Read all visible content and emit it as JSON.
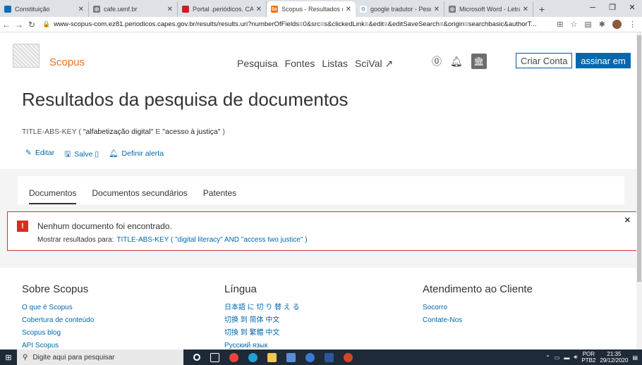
{
  "browser": {
    "tabs": [
      {
        "label": "Constituição",
        "color": "#0a6fb5"
      },
      {
        "label": "cafe.uenf.br",
        "color": "#777777"
      },
      {
        "label": "Portal .periódicos. CAPES",
        "color": "#c42127"
      },
      {
        "label": "Scopus - Resultados da",
        "color": "#e9711c",
        "active": true
      },
      {
        "label": "google tradutor - Pesq",
        "color": "#4285f4"
      },
      {
        "label": "Microsoft Word - Letra",
        "color": "#777777"
      }
    ],
    "new_tab": "+",
    "url": "www-scopus-com.ez81.periodicos.capes.gov.br/results/results.uri?numberOfFields=0&src=s&clickedLink=&edit=&editSaveSearch=&origin=searchbasic&authorT..."
  },
  "header": {
    "logo": "Scopus",
    "nav": [
      "Pesquisa",
      "Fontes",
      "Listas",
      "SciVal ↗"
    ],
    "criar": "Criar Conta",
    "assinar": "assinar em"
  },
  "main": {
    "title": "Resultados da pesquisa de documentos",
    "query_prefix": "TITLE-ABS-KEY  (",
    "term1": "\"alfabetização digital\"",
    "op": "E",
    "term2": "\"acesso à justiça\"",
    "query_suffix": ")",
    "actions": {
      "edit": "Editar",
      "save": "Salve",
      "alert": "Definir alerta"
    },
    "tabs": [
      "Documentos",
      "Documentos secundários",
      "Patentes"
    ],
    "alert": {
      "message": "Nenhum documento foi encontrado.",
      "suggest_label": "Mostrar resultados para:",
      "suggest_link": "TITLE-ABS-KEY  ( \"digital literacy\"  AND  \"access two justice\" )"
    }
  },
  "footer": {
    "cols": [
      {
        "title": "Sobre Scopus",
        "links": [
          "O que é Scopus",
          "Cobertura de conteúdo",
          "Scopus blog",
          "API Scopus"
        ]
      },
      {
        "title": "Língua",
        "links": [
          "日本語 に 切 り 替 え る",
          "切换 到 简体 中文",
          "切換 到 繁體 中文",
          "Русский язык"
        ]
      },
      {
        "title": "Atendimento ao Cliente",
        "links": [
          "Socorro",
          "Contate-Nos"
        ]
      }
    ]
  },
  "taskbar": {
    "search_placeholder": "Digite aqui para pesquisar",
    "lang1": "POR",
    "lang2": "PTB2",
    "time": "21:35",
    "date": "29/12/2020"
  }
}
